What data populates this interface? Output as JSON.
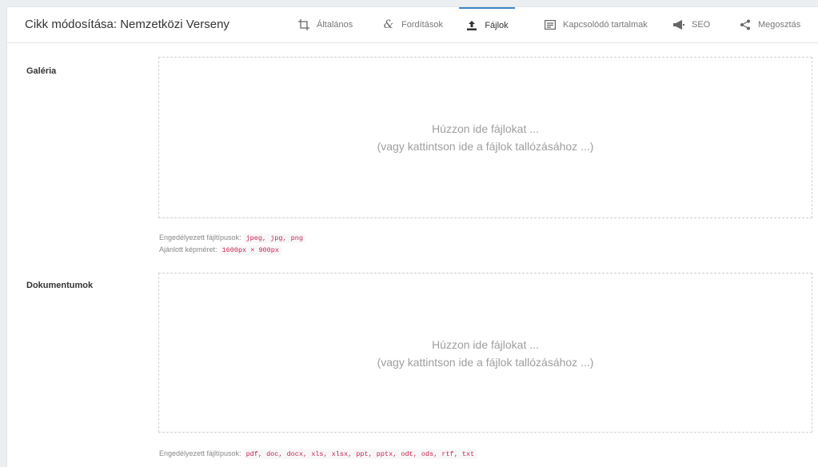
{
  "header": {
    "title": "Cikk módosítása: Nemzetközi Verseny",
    "tabs": [
      {
        "label": "Általános",
        "icon": "crop-icon"
      },
      {
        "label": "Fordítások",
        "icon": "ampersand-icon"
      },
      {
        "label": "Fájlok",
        "icon": "upload-icon",
        "active": true
      },
      {
        "label": "Kapcsolódó tartalmak",
        "icon": "list-box-icon"
      },
      {
        "label": "SEO",
        "icon": "megaphone-icon"
      },
      {
        "label": "Megosztás",
        "icon": "share-icon"
      }
    ]
  },
  "gallery": {
    "label": "Galéria",
    "drop_line1": "Húzzon ide fájlokat ...",
    "drop_line2": "(vagy kattintson ide a fájlok tallózásához ...)",
    "allowed_label": "Engedélyezett fájltípusok:",
    "allowed_types": "jpeg, jpg, png",
    "size_label": "Ajánlott képméret:",
    "size_value": "1600px × 900px"
  },
  "documents": {
    "label": "Dokumentumok",
    "drop_line1": "Húzzon ide fájlokat ...",
    "drop_line2": "(vagy kattintson ide a fájlok tallózásához ...)",
    "allowed_label": "Engedélyezett fájltípusok:",
    "allowed_types": "pdf, doc, docx, xls, xlsx, ppt, pptx, odt, ods, rtf, txt"
  },
  "colors": {
    "active_tab_accent": "#3b86c6",
    "code_text": "#c7254e"
  }
}
